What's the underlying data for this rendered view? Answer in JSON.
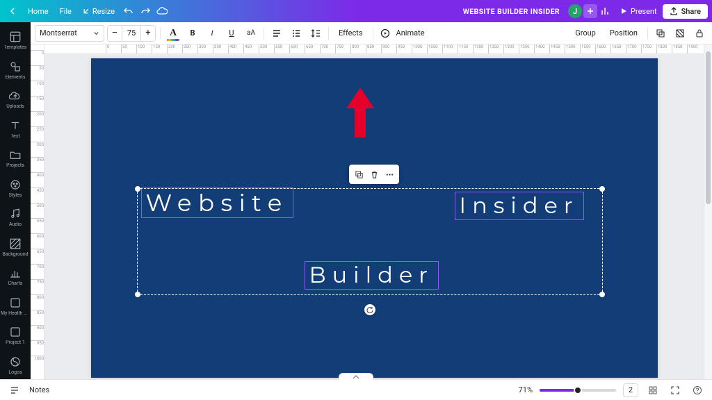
{
  "topbar": {
    "home": "Home",
    "file": "File",
    "resize": "Resize",
    "doc_title": "WEBSITE BUILDER INSIDER",
    "present": "Present",
    "share": "Share",
    "avatar_initial": "J"
  },
  "sidebar": {
    "items": [
      {
        "label": "Templates"
      },
      {
        "label": "Elements"
      },
      {
        "label": "Uploads"
      },
      {
        "label": "Text"
      },
      {
        "label": "Projects"
      },
      {
        "label": "Styles"
      },
      {
        "label": "Audio"
      },
      {
        "label": "Background"
      },
      {
        "label": "Charts"
      },
      {
        "label": "My Health C…"
      },
      {
        "label": "Project 1"
      },
      {
        "label": "Logos"
      }
    ]
  },
  "toolbar": {
    "font": "Montserrat",
    "size": "75",
    "effects": "Effects",
    "animate": "Animate",
    "group": "Group",
    "position": "Position"
  },
  "canvas": {
    "bg": "#123d77",
    "texts": {
      "t1": "Website",
      "t2": "Insider",
      "t3": "Builder"
    }
  },
  "footer": {
    "notes": "Notes",
    "zoom": "71%",
    "page_total": "2"
  },
  "ruler": {
    "h": [
      "0",
      "50",
      "100",
      "150",
      "200",
      "250",
      "300",
      "350",
      "400",
      "450",
      "500",
      "550",
      "600",
      "650",
      "700",
      "750",
      "800",
      "850",
      "900",
      "950",
      "1000",
      "1050",
      "1100",
      "1150",
      "1200",
      "1250",
      "1300",
      "1350",
      "1400",
      "1450",
      "1500",
      "1550",
      "1600",
      "1650",
      "1700",
      "1750",
      "1800",
      "1850",
      "1900"
    ],
    "v": [
      "0",
      "50",
      "100",
      "150",
      "200",
      "250",
      "300",
      "350",
      "400",
      "450",
      "500",
      "550",
      "600",
      "650",
      "700",
      "750",
      "800",
      "850",
      "900",
      "950",
      "1000"
    ]
  }
}
